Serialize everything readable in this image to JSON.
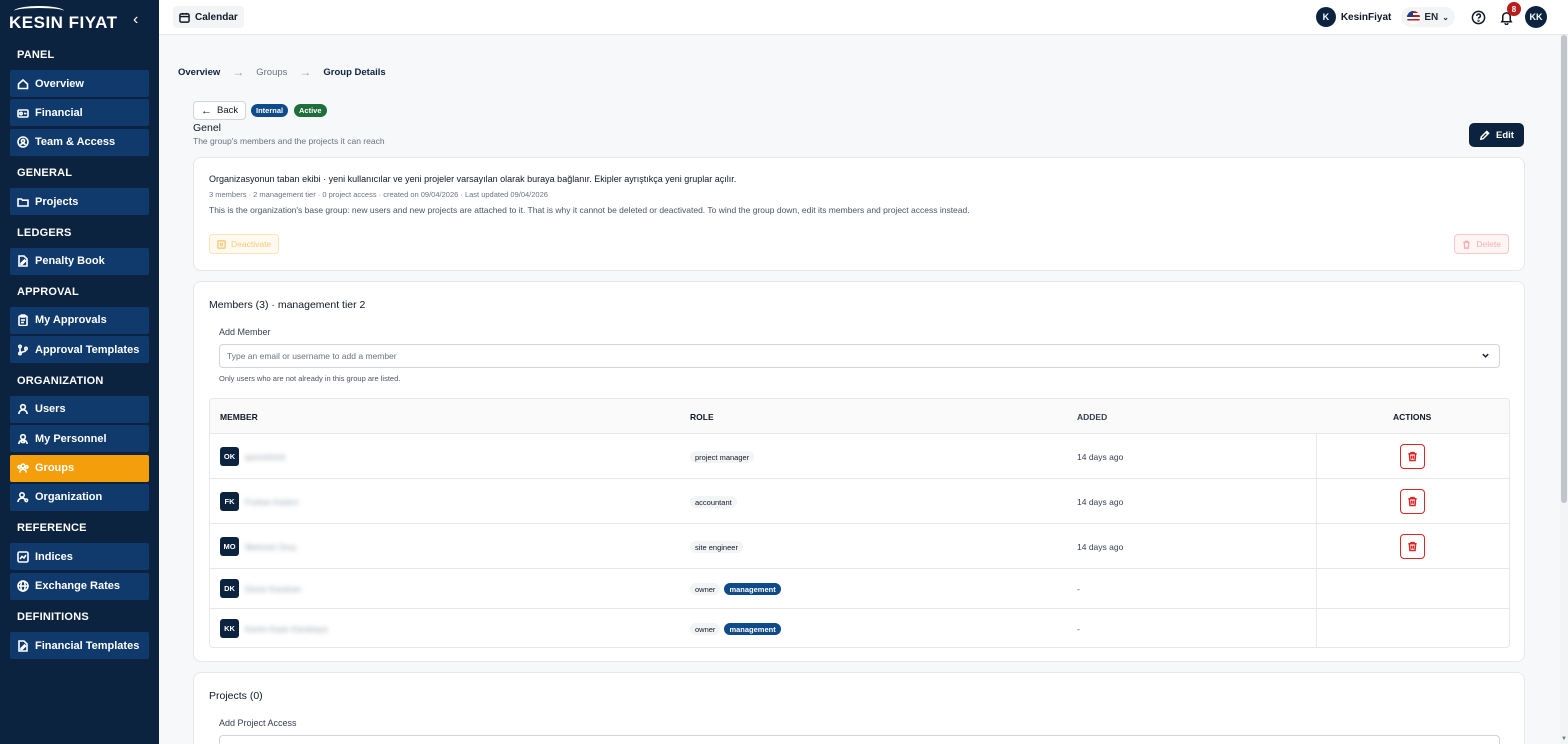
{
  "brand": {
    "name": "KESIN FIYAT"
  },
  "sidebar": {
    "sections": [
      {
        "title": "PANEL",
        "items": [
          {
            "label": "Overview",
            "icon": "home-icon"
          },
          {
            "label": "Financial",
            "icon": "wallet-icon"
          },
          {
            "label": "Team & Access",
            "icon": "shield-user-icon"
          }
        ]
      },
      {
        "title": "GENERAL",
        "items": [
          {
            "label": "Projects",
            "icon": "folder-icon"
          }
        ]
      },
      {
        "title": "LEDGERS",
        "items": [
          {
            "label": "Penalty Book",
            "icon": "file-edit-icon"
          }
        ]
      },
      {
        "title": "APPROVAL",
        "items": [
          {
            "label": "My Approvals",
            "icon": "clipboard-icon"
          },
          {
            "label": "Approval Templates",
            "icon": "branch-icon"
          }
        ]
      },
      {
        "title": "ORGANIZATION",
        "items": [
          {
            "label": "Users",
            "icon": "user-icon"
          },
          {
            "label": "My Personnel",
            "icon": "users-icon"
          },
          {
            "label": "Groups",
            "icon": "group-icon",
            "active": true
          },
          {
            "label": "Organization",
            "icon": "user-cog-icon"
          }
        ]
      },
      {
        "title": "REFERENCE",
        "items": [
          {
            "label": "Indices",
            "icon": "chart-icon"
          },
          {
            "label": "Exchange Rates",
            "icon": "globe-icon"
          }
        ]
      },
      {
        "title": "DEFINITIONS",
        "items": [
          {
            "label": "Financial Templates",
            "icon": "file-edit-icon"
          }
        ]
      }
    ]
  },
  "topbar": {
    "calendar_label": "Calendar",
    "user_initial": "K",
    "user_name": "KesinFiyat",
    "language": "EN",
    "notification_count": "8",
    "avatar_initials": "KK"
  },
  "breadcrumb": {
    "overview": "Overview",
    "groups": "Groups",
    "current": "Group Details"
  },
  "group": {
    "back_label": "Back",
    "badge_internal": "Internal",
    "badge_active": "Active",
    "name": "Genel",
    "subtitle": "The group's members and the projects it can reach",
    "edit_label": "Edit",
    "description": "Organizasyonun taban ekibi · yeni kullanıcılar ve yeni projeler varsayılan olarak buraya bağlanır. Ekipler ayrıştıkça yeni gruplar açılır.",
    "meta": "3 members · 2 management tier · 0 project access · created on 09/04/2026 · Last updated 09/04/2026",
    "notice": "This is the organization's base group: new users and new projects are attached to it. That is why it cannot be deleted or deactivated. To wind the group down, edit its members and project access instead.",
    "deactivate_label": "Deactivate",
    "delete_label": "Delete"
  },
  "members": {
    "title": "Members (3) · management tier 2",
    "add_label": "Add Member",
    "placeholder": "Type an email or username to add a member",
    "hint": "Only users who are not already in this group are listed.",
    "columns": {
      "member": "MEMBER",
      "role": "ROLE",
      "added": "ADDED",
      "actions": "ACTIONS"
    },
    "rows": [
      {
        "initials": "OK",
        "name": "qonorkhmt",
        "roles": [
          {
            "text": "project manager",
            "kind": "plain"
          }
        ],
        "added": "14 days ago",
        "deletable": true
      },
      {
        "initials": "FK",
        "name": "Furkan Kadım",
        "roles": [
          {
            "text": "accountant",
            "kind": "plain"
          }
        ],
        "added": "14 days ago",
        "deletable": true
      },
      {
        "initials": "MO",
        "name": "Mehmet Oruç",
        "roles": [
          {
            "text": "site engineer",
            "kind": "plain"
          }
        ],
        "added": "14 days ago",
        "deletable": true
      },
      {
        "initials": "DK",
        "name": "Deniz Karahan",
        "roles": [
          {
            "text": "owner",
            "kind": "plain"
          },
          {
            "text": "management",
            "kind": "mgmt"
          }
        ],
        "added": "-",
        "deletable": false
      },
      {
        "initials": "KK",
        "name": "Kerim Kaan Karakaya",
        "roles": [
          {
            "text": "owner",
            "kind": "plain"
          },
          {
            "text": "management",
            "kind": "mgmt"
          }
        ],
        "added": "-",
        "deletable": false
      }
    ]
  },
  "projects": {
    "title": "Projects (0)",
    "add_label": "Add Project Access"
  },
  "colors": {
    "sidebar_bg": "#0c2340",
    "nav_item_bg": "#0f3a6b",
    "active_item": "#f59e0b",
    "danger": "#dc2626"
  }
}
